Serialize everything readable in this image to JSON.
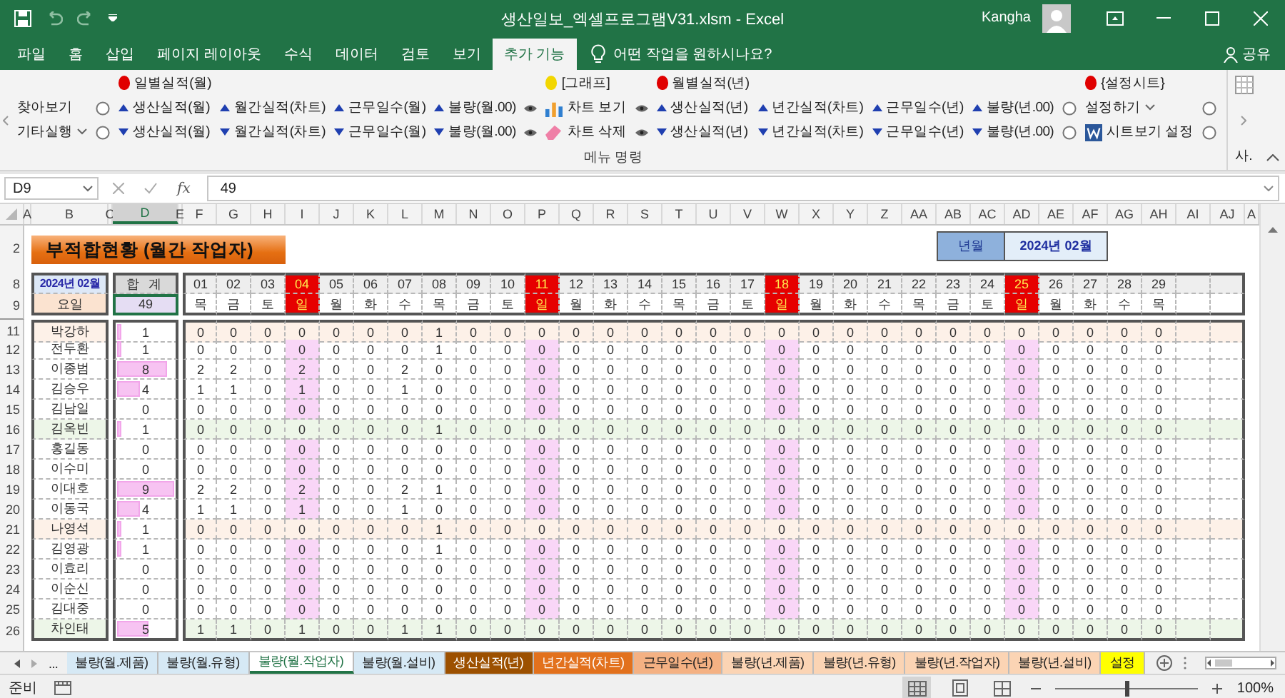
{
  "title_bar": {
    "title": "생산일보_엑셀프로그램V31.xlsm  -  Excel",
    "user": "Kangha"
  },
  "menu_tabs": [
    {
      "label": "파일",
      "selected": false
    },
    {
      "label": "홈",
      "selected": false
    },
    {
      "label": "삽입",
      "selected": false
    },
    {
      "label": "페이지 레이아웃",
      "selected": false
    },
    {
      "label": "수식",
      "selected": false
    },
    {
      "label": "데이터",
      "selected": false
    },
    {
      "label": "검토",
      "selected": false
    },
    {
      "label": "보기",
      "selected": false
    },
    {
      "label": "추가 기능",
      "selected": true
    }
  ],
  "tell_me": "어떤 작업을 원하시나요?",
  "share": "공유",
  "ribbon": {
    "columns": [
      {
        "items": [
          {
            "kind": "text",
            "label": "찾아보기"
          },
          {
            "kind": "dropdown",
            "label": "기타실행"
          }
        ]
      },
      {
        "items": [
          {
            "kind": "radio"
          },
          {
            "kind": "radio"
          }
        ]
      },
      {
        "header": {
          "label": "일별실적(월)",
          "color": "#e00000"
        },
        "items": [
          {
            "kind": "up",
            "label": "생산실적(월)"
          },
          {
            "kind": "down",
            "label": "생산실적(월)"
          }
        ]
      },
      {
        "items": [
          {
            "kind": "up",
            "label": "월간실적(차트)"
          },
          {
            "kind": "down",
            "label": "월간실적(차트)"
          }
        ]
      },
      {
        "items": [
          {
            "kind": "up",
            "label": "근무일수(월)"
          },
          {
            "kind": "down",
            "label": "근무일수(월)"
          }
        ]
      },
      {
        "items": [
          {
            "kind": "up",
            "label": "불량(월.00)"
          },
          {
            "kind": "down",
            "label": "불량(월.00)"
          }
        ]
      },
      {
        "items": [
          {
            "kind": "eye"
          },
          {
            "kind": "eye"
          }
        ]
      },
      {
        "header": {
          "label": "[그래프]",
          "color": "#f2d600"
        },
        "items": [
          {
            "kind": "chart",
            "label": "차트 보기"
          },
          {
            "kind": "eraser",
            "label": "차트 삭제"
          }
        ]
      },
      {
        "items": [
          {
            "kind": "eye"
          },
          {
            "kind": "eye"
          }
        ]
      },
      {
        "header": {
          "label": "월별실적(년)",
          "color": "#e00000"
        },
        "items": [
          {
            "kind": "up",
            "label": "생산실적(년)"
          },
          {
            "kind": "down",
            "label": "생산실적(년)"
          }
        ]
      },
      {
        "items": [
          {
            "kind": "up",
            "label": "년간실적(차트)"
          },
          {
            "kind": "down",
            "label": "년간실적(차트)"
          }
        ]
      },
      {
        "items": [
          {
            "kind": "up",
            "label": "근무일수(년)"
          },
          {
            "kind": "down",
            "label": "근무일수(년)"
          }
        ]
      },
      {
        "items": [
          {
            "kind": "up",
            "label": "불량(년.00)"
          },
          {
            "kind": "down",
            "label": "불량(년.00)"
          }
        ]
      },
      {
        "items": [
          {
            "kind": "radio"
          },
          {
            "kind": "radio"
          }
        ]
      },
      {
        "header": {
          "label": "{설정시트}",
          "color": "#e00000"
        },
        "items": [
          {
            "kind": "dropdown",
            "label": "설정하기"
          },
          {
            "kind": "word",
            "label": "시트보기 설정"
          }
        ]
      },
      {
        "items": [
          {
            "kind": "radio"
          },
          {
            "kind": "radio"
          }
        ]
      }
    ],
    "group_label": "메뉴 명령",
    "collapsed_label": "사."
  },
  "formula_bar": {
    "name_box": "D9",
    "function_label": "fx",
    "value": "49"
  },
  "columns": [
    "A",
    "B",
    "C",
    "D",
    "E",
    "F",
    "G",
    "H",
    "I",
    "J",
    "K",
    "L",
    "M",
    "N",
    "O",
    "P",
    "Q",
    "R",
    "S",
    "T",
    "U",
    "V",
    "W",
    "X",
    "Y",
    "Z",
    "AA",
    "AB",
    "AC",
    "AD",
    "AE",
    "AF",
    "AG",
    "AH",
    "AI",
    "AJ",
    "A"
  ],
  "sheet": {
    "title_row": "2",
    "title": "부적합현황 (월간 작업자)",
    "period_label": "년월",
    "period_value": "2024년 02월",
    "date_row": "8",
    "weekday_row": "9",
    "month_label": "2024년 02월",
    "weekday_label": "요일",
    "total_label": "합 계",
    "total_value": "49",
    "days": [
      {
        "date": "01",
        "weekday": "목",
        "holiday": false
      },
      {
        "date": "02",
        "weekday": "금",
        "holiday": false
      },
      {
        "date": "03",
        "weekday": "토",
        "holiday": false
      },
      {
        "date": "04",
        "weekday": "일",
        "holiday": true
      },
      {
        "date": "05",
        "weekday": "월",
        "holiday": false
      },
      {
        "date": "06",
        "weekday": "화",
        "holiday": false
      },
      {
        "date": "07",
        "weekday": "수",
        "holiday": false
      },
      {
        "date": "08",
        "weekday": "목",
        "holiday": false
      },
      {
        "date": "09",
        "weekday": "금",
        "holiday": false
      },
      {
        "date": "10",
        "weekday": "토",
        "holiday": false
      },
      {
        "date": "11",
        "weekday": "일",
        "holiday": true
      },
      {
        "date": "12",
        "weekday": "월",
        "holiday": false
      },
      {
        "date": "13",
        "weekday": "화",
        "holiday": false
      },
      {
        "date": "14",
        "weekday": "수",
        "holiday": false
      },
      {
        "date": "15",
        "weekday": "목",
        "holiday": false
      },
      {
        "date": "16",
        "weekday": "금",
        "holiday": false
      },
      {
        "date": "17",
        "weekday": "토",
        "holiday": false
      },
      {
        "date": "18",
        "weekday": "일",
        "holiday": true
      },
      {
        "date": "19",
        "weekday": "월",
        "holiday": false
      },
      {
        "date": "20",
        "weekday": "화",
        "holiday": false
      },
      {
        "date": "21",
        "weekday": "수",
        "holiday": false
      },
      {
        "date": "22",
        "weekday": "목",
        "holiday": false
      },
      {
        "date": "23",
        "weekday": "금",
        "holiday": false
      },
      {
        "date": "24",
        "weekday": "토",
        "holiday": false
      },
      {
        "date": "25",
        "weekday": "일",
        "holiday": true
      },
      {
        "date": "26",
        "weekday": "월",
        "holiday": false
      },
      {
        "date": "27",
        "weekday": "화",
        "holiday": false
      },
      {
        "date": "28",
        "weekday": "수",
        "holiday": false
      },
      {
        "date": "29",
        "weekday": "목",
        "holiday": false
      }
    ],
    "rows": [
      {
        "row": "11",
        "name": "박강하",
        "total": "1",
        "level": 0.11,
        "color": "#fdf1e8",
        "values": [
          "0",
          "0",
          "0",
          "0",
          "0",
          "0",
          "0",
          "1",
          "0",
          "0",
          "0",
          "0",
          "0",
          "0",
          "0",
          "0",
          "0",
          "0",
          "0",
          "0",
          "0",
          "0",
          "0",
          "0",
          "0",
          "0",
          "0",
          "0",
          "0"
        ]
      },
      {
        "row": "12",
        "name": "전두환",
        "total": "1",
        "level": 0.11,
        "values": [
          "0",
          "0",
          "0",
          "0",
          "0",
          "0",
          "0",
          "1",
          "0",
          "0",
          "0",
          "0",
          "0",
          "0",
          "0",
          "0",
          "0",
          "0",
          "0",
          "0",
          "0",
          "0",
          "0",
          "0",
          "0",
          "0",
          "0",
          "0",
          "0"
        ]
      },
      {
        "row": "13",
        "name": "이종범",
        "total": "8",
        "level": 0.89,
        "values": [
          "2",
          "2",
          "0",
          "2",
          "0",
          "0",
          "2",
          "0",
          "0",
          "0",
          "0",
          "0",
          "0",
          "0",
          "0",
          "0",
          "0",
          "0",
          "0",
          "0",
          "0",
          "0",
          "0",
          "0",
          "0",
          "0",
          "0",
          "0",
          "0"
        ]
      },
      {
        "row": "14",
        "name": "김승우",
        "total": "4",
        "level": 0.44,
        "values": [
          "1",
          "1",
          "0",
          "1",
          "0",
          "0",
          "1",
          "0",
          "0",
          "0",
          "0",
          "0",
          "0",
          "0",
          "0",
          "0",
          "0",
          "0",
          "0",
          "0",
          "0",
          "0",
          "0",
          "0",
          "0",
          "0",
          "0",
          "0",
          "0"
        ]
      },
      {
        "row": "15",
        "name": "김남일",
        "total": "0",
        "values": [
          "0",
          "0",
          "0",
          "0",
          "0",
          "0",
          "0",
          "0",
          "0",
          "0",
          "0",
          "0",
          "0",
          "0",
          "0",
          "0",
          "0",
          "0",
          "0",
          "0",
          "0",
          "0",
          "0",
          "0",
          "0",
          "0",
          "0",
          "0",
          "0"
        ]
      },
      {
        "row": "16",
        "name": "김옥빈",
        "total": "1",
        "level": 0.11,
        "color": "#edf6e8",
        "values": [
          "0",
          "0",
          "0",
          "0",
          "0",
          "0",
          "0",
          "1",
          "0",
          "0",
          "0",
          "0",
          "0",
          "0",
          "0",
          "0",
          "0",
          "0",
          "0",
          "0",
          "0",
          "0",
          "0",
          "0",
          "0",
          "0",
          "0",
          "0",
          "0"
        ]
      },
      {
        "row": "17",
        "name": "홍길동",
        "total": "0",
        "values": [
          "0",
          "0",
          "0",
          "0",
          "0",
          "0",
          "0",
          "0",
          "0",
          "0",
          "0",
          "0",
          "0",
          "0",
          "0",
          "0",
          "0",
          "0",
          "0",
          "0",
          "0",
          "0",
          "0",
          "0",
          "0",
          "0",
          "0",
          "0",
          "0"
        ]
      },
      {
        "row": "18",
        "name": "이수미",
        "total": "0",
        "values": [
          "0",
          "0",
          "0",
          "0",
          "0",
          "0",
          "0",
          "0",
          "0",
          "0",
          "0",
          "0",
          "0",
          "0",
          "0",
          "0",
          "0",
          "0",
          "0",
          "0",
          "0",
          "0",
          "0",
          "0",
          "0",
          "0",
          "0",
          "0",
          "0"
        ]
      },
      {
        "row": "19",
        "name": "이대호",
        "total": "9",
        "level": 1,
        "values": [
          "2",
          "2",
          "0",
          "2",
          "0",
          "0",
          "2",
          "1",
          "0",
          "0",
          "0",
          "0",
          "0",
          "0",
          "0",
          "0",
          "0",
          "0",
          "0",
          "0",
          "0",
          "0",
          "0",
          "0",
          "0",
          "0",
          "0",
          "0",
          "0"
        ]
      },
      {
        "row": "20",
        "name": "이동국",
        "total": "4",
        "level": 0.44,
        "values": [
          "1",
          "1",
          "0",
          "1",
          "0",
          "0",
          "1",
          "0",
          "0",
          "0",
          "0",
          "0",
          "0",
          "0",
          "0",
          "0",
          "0",
          "0",
          "0",
          "0",
          "0",
          "0",
          "0",
          "0",
          "0",
          "0",
          "0",
          "0",
          "0"
        ]
      },
      {
        "row": "21",
        "name": "나영석",
        "total": "1",
        "level": 0.11,
        "color": "#fdf1e8",
        "values": [
          "0",
          "0",
          "0",
          "0",
          "0",
          "0",
          "0",
          "1",
          "0",
          "0",
          "0",
          "0",
          "0",
          "0",
          "0",
          "0",
          "0",
          "0",
          "0",
          "0",
          "0",
          "0",
          "0",
          "0",
          "0",
          "0",
          "0",
          "0",
          "0"
        ]
      },
      {
        "row": "22",
        "name": "김영광",
        "total": "1",
        "level": 0.11,
        "values": [
          "0",
          "0",
          "0",
          "0",
          "0",
          "0",
          "0",
          "1",
          "0",
          "0",
          "0",
          "0",
          "0",
          "0",
          "0",
          "0",
          "0",
          "0",
          "0",
          "0",
          "0",
          "0",
          "0",
          "0",
          "0",
          "0",
          "0",
          "0",
          "0"
        ]
      },
      {
        "row": "23",
        "name": "이효리",
        "total": "0",
        "values": [
          "0",
          "0",
          "0",
          "0",
          "0",
          "0",
          "0",
          "0",
          "0",
          "0",
          "0",
          "0",
          "0",
          "0",
          "0",
          "0",
          "0",
          "0",
          "0",
          "0",
          "0",
          "0",
          "0",
          "0",
          "0",
          "0",
          "0",
          "0",
          "0"
        ]
      },
      {
        "row": "24",
        "name": "이순신",
        "total": "0",
        "values": [
          "0",
          "0",
          "0",
          "0",
          "0",
          "0",
          "0",
          "0",
          "0",
          "0",
          "0",
          "0",
          "0",
          "0",
          "0",
          "0",
          "0",
          "0",
          "0",
          "0",
          "0",
          "0",
          "0",
          "0",
          "0",
          "0",
          "0",
          "0",
          "0"
        ]
      },
      {
        "row": "25",
        "name": "김대중",
        "total": "0",
        "values": [
          "0",
          "0",
          "0",
          "0",
          "0",
          "0",
          "0",
          "0",
          "0",
          "0",
          "0",
          "0",
          "0",
          "0",
          "0",
          "0",
          "0",
          "0",
          "0",
          "0",
          "0",
          "0",
          "0",
          "0",
          "0",
          "0",
          "0",
          "0",
          "0"
        ]
      },
      {
        "row": "26",
        "name": "차인태",
        "total": "5",
        "level": 0.56,
        "color": "#edf6e8",
        "values": [
          "1",
          "1",
          "0",
          "1",
          "0",
          "0",
          "1",
          "1",
          "0",
          "0",
          "0",
          "0",
          "0",
          "0",
          "0",
          "0",
          "0",
          "0",
          "0",
          "0",
          "0",
          "0",
          "0",
          "0",
          "0",
          "0",
          "0",
          "0",
          "0"
        ]
      }
    ]
  },
  "sheet_nav": "...",
  "sheet_tabs": [
    {
      "label": "불량(월.제품)",
      "color": "#d6e9f5",
      "selected": false
    },
    {
      "label": "불량(월.유형)",
      "color": "#d6e9f5",
      "selected": false
    },
    {
      "label": "불량(월.작업자)",
      "selected": true
    },
    {
      "label": "불량(월.설비)",
      "color": "#d6e9f5",
      "selected": false
    },
    {
      "label": "생산실적(년)",
      "color": "#9c5000",
      "selected": false
    },
    {
      "label": "년간실적(차트)",
      "color": "#e2711d",
      "selected": false
    },
    {
      "label": "근무일수(년)",
      "color": "#f4b183",
      "selected": false
    },
    {
      "label": "불량(년.제품)",
      "color": "#fbd4b4",
      "selected": false
    },
    {
      "label": "불량(년.유형)",
      "color": "#fbd4b4",
      "selected": false
    },
    {
      "label": "불량(년.작업자)",
      "color": "#fbd4b4",
      "selected": false
    },
    {
      "label": "불량(년.설비)",
      "color": "#fbd4b4",
      "selected": false
    },
    {
      "label": "설정",
      "color": "#ffff00",
      "selected": false
    }
  ],
  "status_bar": {
    "status": "준비",
    "zoom": "100%",
    "zoom_slider": {
      "level": 0.5
    }
  }
}
